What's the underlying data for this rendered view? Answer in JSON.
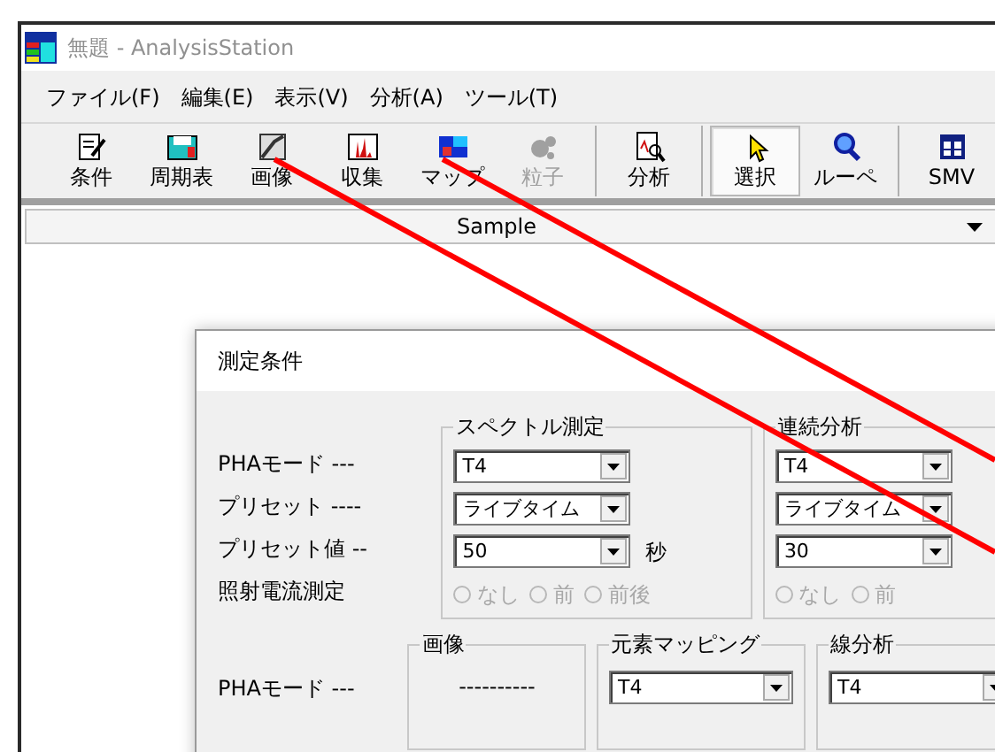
{
  "window": {
    "title": "無題 - AnalysisStation"
  },
  "menu": [
    "ファイル(F)",
    "編集(E)",
    "表示(V)",
    "分析(A)",
    "ツール(T)"
  ],
  "toolbar": [
    {
      "label": "条件",
      "kind": "edit",
      "disabled": false,
      "selected": false
    },
    {
      "label": "周期表",
      "kind": "table",
      "disabled": false,
      "selected": false
    },
    {
      "label": "画像",
      "kind": "image",
      "disabled": false,
      "selected": false
    },
    {
      "label": "収集",
      "kind": "spectrum",
      "disabled": false,
      "selected": false
    },
    {
      "label": "マップ",
      "kind": "map",
      "disabled": false,
      "selected": false
    },
    {
      "label": "粒子",
      "kind": "particle",
      "disabled": true,
      "selected": false
    },
    {
      "label": "分析",
      "kind": "analysis",
      "disabled": false,
      "selected": false
    },
    {
      "label": "選択",
      "kind": "pointer",
      "disabled": false,
      "selected": true
    },
    {
      "label": "ルーペ",
      "kind": "loupe",
      "disabled": false,
      "selected": false
    },
    {
      "label": "SMV",
      "kind": "smv",
      "disabled": false,
      "selected": false
    }
  ],
  "sample_bar": {
    "label": "Sample"
  },
  "dialog": {
    "title": "測定条件",
    "row_labels": [
      "PHAモード ---",
      "プリセット ----",
      "プリセット値 --",
      "照射電流測定"
    ],
    "groups": [
      {
        "title": "スペクトル測定",
        "pha": "T4",
        "preset": "ライブタイム",
        "preset_value": "50",
        "unit": "秒",
        "radios": [
          {
            "label": "なし",
            "selected": false,
            "disabled": true
          },
          {
            "label": "前",
            "selected": false,
            "disabled": true
          },
          {
            "label": "前後",
            "selected": false,
            "disabled": true
          }
        ]
      },
      {
        "title": "連続分析",
        "pha": "T4",
        "preset": "ライブタイム",
        "preset_value": "30",
        "radios": [
          {
            "label": "なし",
            "selected": false,
            "disabled": true
          },
          {
            "label": "前",
            "selected": false,
            "disabled": true
          }
        ]
      }
    ],
    "lower_row_label": "PHAモード ---",
    "lower_groups": [
      {
        "title": "画像",
        "kind": "text",
        "value": "----------"
      },
      {
        "title": "元素マッピング",
        "kind": "select",
        "value": "T4"
      },
      {
        "title": "線分析",
        "kind": "select",
        "value": "T4"
      }
    ]
  }
}
